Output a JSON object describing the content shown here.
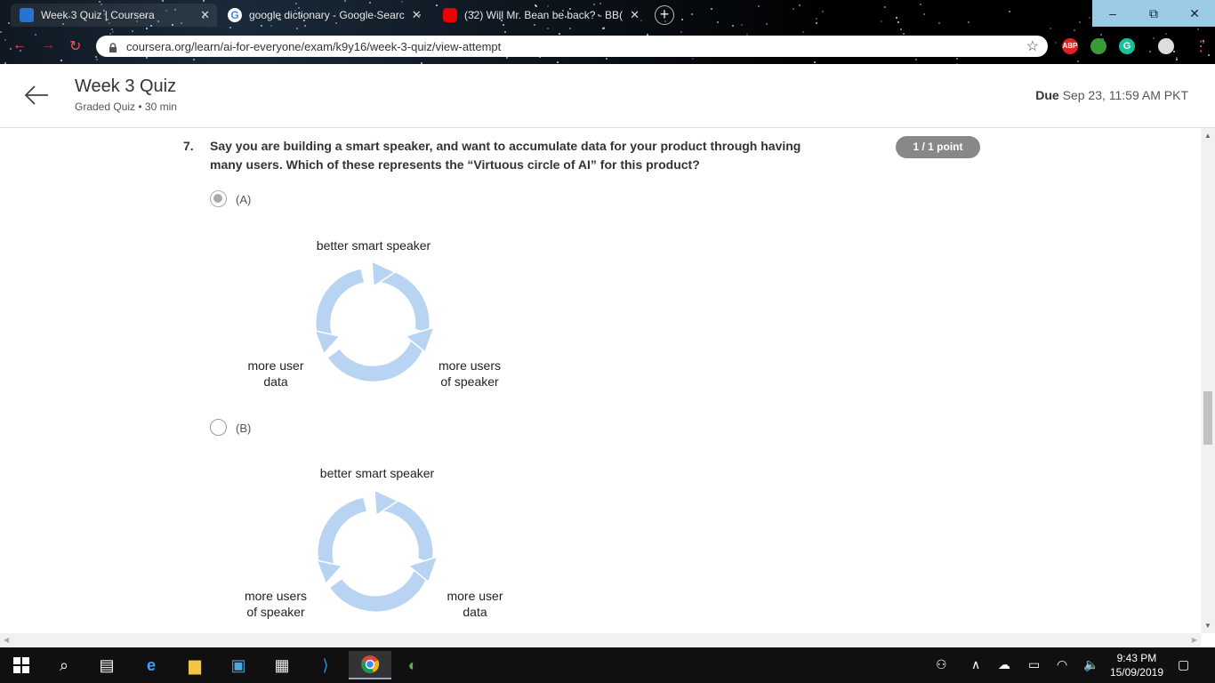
{
  "browser": {
    "tabs": [
      {
        "title": "Week 3 Quiz | Coursera",
        "active": true
      },
      {
        "title": "google dictionary - Google Searc",
        "active": false
      },
      {
        "title": "(32) Will Mr. Bean be back? - BB(",
        "active": false
      }
    ],
    "new_tab": "+",
    "url": "coursera.org/learn/ai-for-everyone/exam/k9y16/week-3-quiz/view-attempt",
    "ext_abp": "ABP",
    "window": {
      "minimize": "–",
      "restore": "⧉",
      "close": "✕"
    }
  },
  "header": {
    "title": "Week 3 Quiz",
    "subtitle": "Graded Quiz • 30 min",
    "due_label": "Due",
    "due_value": "Sep 23, 11:59 AM PKT"
  },
  "question": {
    "number": "7.",
    "text": "Say you are building a smart speaker, and want to accumulate data for your product through having many users. Which of these represents the “Virtuous circle of AI” for this product?",
    "points": "1 / 1 point",
    "options": [
      {
        "label": "(A)",
        "selected": true,
        "top": "better smart speaker",
        "left": "more user\ndata",
        "right": "more users\nof speaker"
      },
      {
        "label": "(B)",
        "selected": false,
        "top": "better smart speaker",
        "left": "more users\nof speaker",
        "right": "more user\ndata"
      }
    ]
  },
  "taskbar": {
    "time": "9:43 PM",
    "date": "15/09/2019"
  },
  "colors": {
    "cycle": "#b8d4f2",
    "points_badge": "#888888"
  }
}
